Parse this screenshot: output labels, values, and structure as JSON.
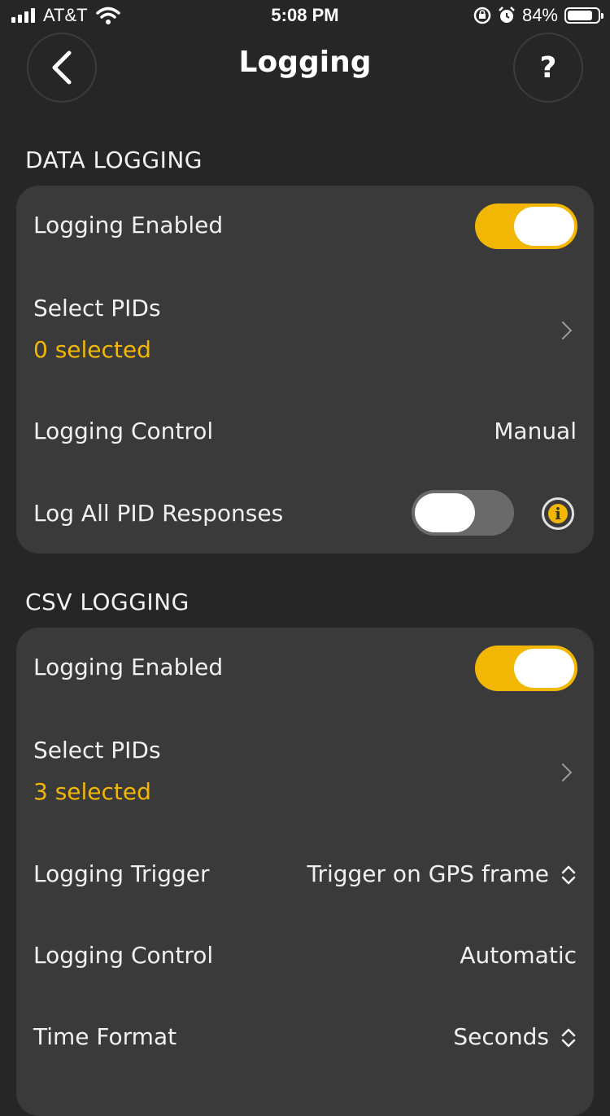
{
  "status_bar": {
    "carrier": "AT&T",
    "time": "5:08 PM",
    "battery_percent": "84%",
    "battery_level": 0.84
  },
  "nav": {
    "title": "Logging",
    "help_label": "?"
  },
  "data_logging": {
    "header": "DATA LOGGING",
    "logging_enabled": {
      "label": "Logging Enabled",
      "on": true
    },
    "select_pids": {
      "label": "Select PIDs",
      "value": "0 selected"
    },
    "logging_control": {
      "label": "Logging Control",
      "value": "Manual"
    },
    "log_all_pid": {
      "label": "Log All PID Responses",
      "on": false,
      "info": "i"
    }
  },
  "csv_logging": {
    "header": "CSV LOGGING",
    "logging_enabled": {
      "label": "Logging Enabled",
      "on": true
    },
    "select_pids": {
      "label": "Select PIDs",
      "value": "3 selected"
    },
    "logging_trigger": {
      "label": "Logging Trigger",
      "value": "Trigger on GPS frame"
    },
    "logging_control": {
      "label": "Logging Control",
      "value": "Automatic"
    },
    "time_format": {
      "label": "Time Format",
      "value": "Seconds"
    }
  },
  "colors": {
    "accent": "#f2b705",
    "background": "#262626",
    "card": "#3a3a3a"
  }
}
